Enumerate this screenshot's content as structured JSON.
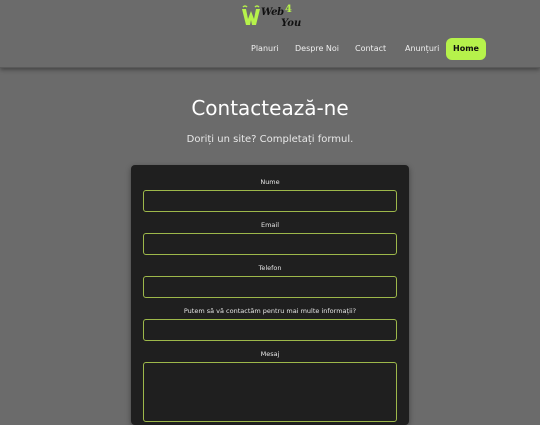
{
  "brand": {
    "logo_text_line1": "Web",
    "logo_digit": "4",
    "logo_text_line2": "You",
    "accent_color": "#b6f24b"
  },
  "nav": {
    "items": [
      {
        "label": "Planuri"
      },
      {
        "label": "Despre Noi"
      },
      {
        "label": "Contact"
      },
      {
        "label": "Anunțuri"
      }
    ],
    "home_label": "Home"
  },
  "page": {
    "title": "Contactează-ne",
    "subtitle": "Doriți un site? Completați formul."
  },
  "form": {
    "fields": [
      {
        "label": "Nume",
        "value": ""
      },
      {
        "label": "Email",
        "value": ""
      },
      {
        "label": "Telefon",
        "value": ""
      },
      {
        "label": "Putem să vă contactăm pentru mai multe informații?",
        "value": ""
      },
      {
        "label": "Mesaj",
        "value": ""
      }
    ]
  }
}
